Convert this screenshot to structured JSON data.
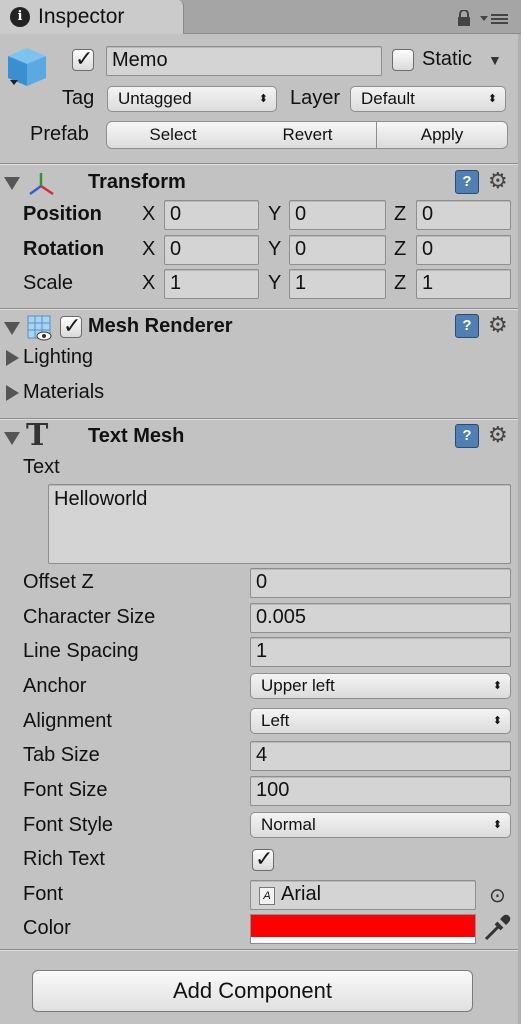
{
  "window": {
    "tab_title": "Inspector"
  },
  "object": {
    "name": "Memo",
    "active": true,
    "static_label": "Static",
    "static_checked": false,
    "tag_label": "Tag",
    "tag_value": "Untagged",
    "layer_label": "Layer",
    "layer_value": "Default",
    "prefab_label": "Prefab",
    "prefab_buttons": [
      "Select",
      "Revert",
      "Apply"
    ]
  },
  "transform": {
    "title": "Transform",
    "rows": [
      {
        "label": "Position",
        "bold": true,
        "x": "0",
        "y": "0",
        "z": "0"
      },
      {
        "label": "Rotation",
        "bold": true,
        "x": "0",
        "y": "0",
        "z": "0"
      },
      {
        "label": "Scale",
        "bold": false,
        "x": "1",
        "y": "1",
        "z": "1"
      }
    ],
    "axis_x": "X",
    "axis_y": "Y",
    "axis_z": "Z"
  },
  "mesh_renderer": {
    "title": "Mesh Renderer",
    "enabled": true,
    "lighting_label": "Lighting",
    "materials_label": "Materials"
  },
  "text_mesh": {
    "title": "Text Mesh",
    "text_label": "Text",
    "text_value": "Helloworld",
    "offset_z_label": "Offset Z",
    "offset_z": "0",
    "character_size_label": "Character Size",
    "character_size": "0.005",
    "line_spacing_label": "Line Spacing",
    "line_spacing": "1",
    "anchor_label": "Anchor",
    "anchor": "Upper left",
    "alignment_label": "Alignment",
    "alignment": "Left",
    "tab_size_label": "Tab Size",
    "tab_size": "4",
    "font_size_label": "Font Size",
    "font_size": "100",
    "font_style_label": "Font Style",
    "font_style": "Normal",
    "rich_text_label": "Rich Text",
    "rich_text": true,
    "font_label": "Font",
    "font": "Arial",
    "color_label": "Color",
    "color": "#ff0000"
  },
  "add_component_label": "Add Component",
  "icons": {
    "info": "i",
    "dropdown_arrow": "▼",
    "select_arrows": "⬍",
    "help": "?",
    "gear": "⚙",
    "check": "✓",
    "target": "⊙"
  }
}
